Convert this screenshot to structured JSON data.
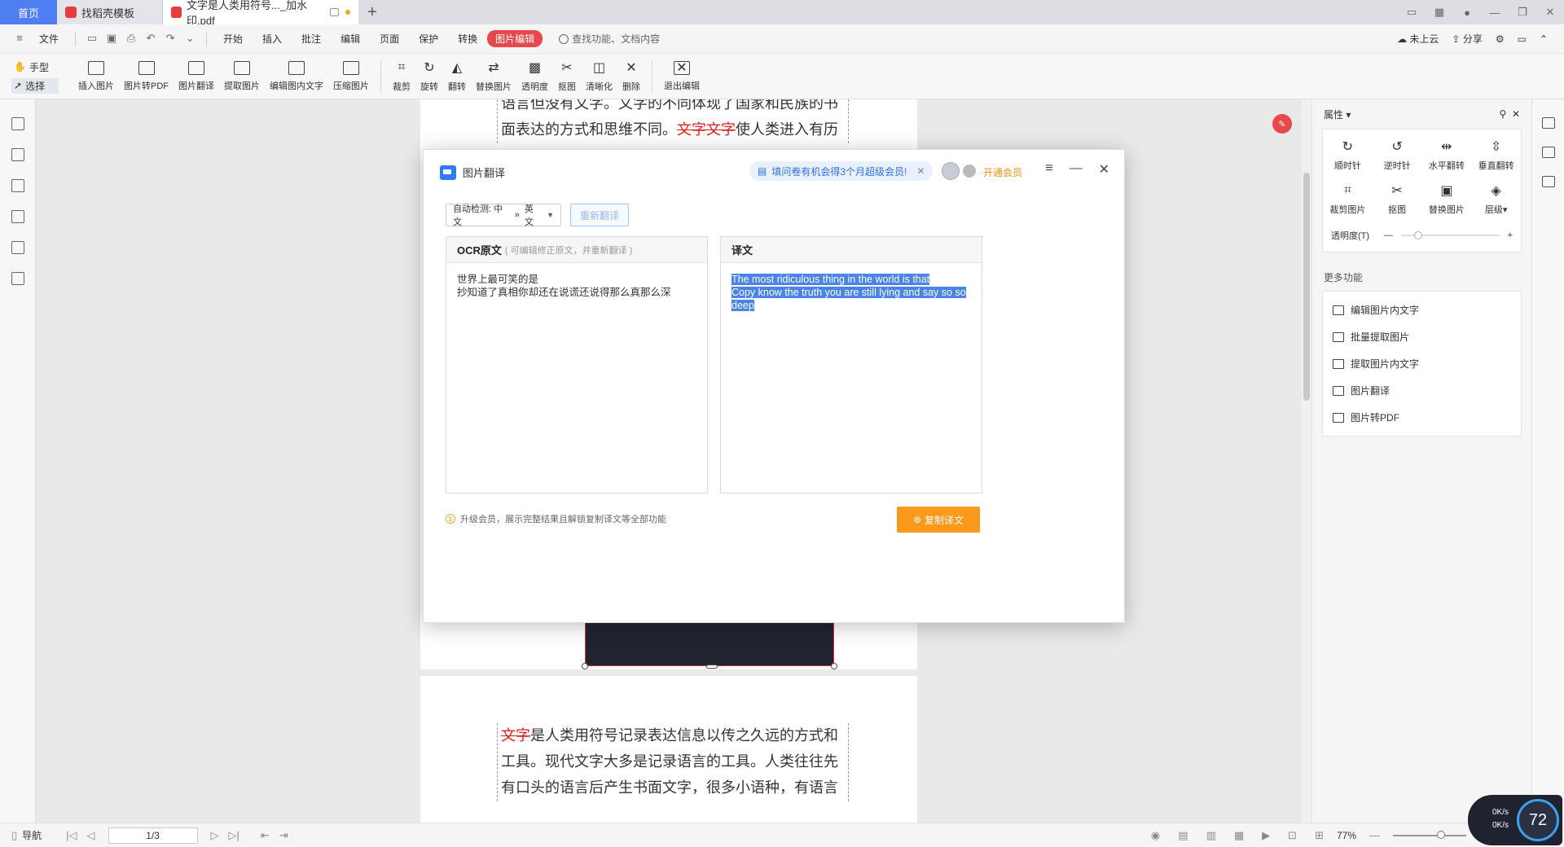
{
  "tabs": {
    "home": "首页",
    "template": "找稻壳模板",
    "doc": "文字是人类用符号..._加水印.pdf"
  },
  "menu": {
    "file": "文件",
    "items": [
      "开始",
      "插入",
      "批注",
      "编辑",
      "页面",
      "保护",
      "转换"
    ],
    "active": "图片编辑",
    "search": "查找功能、文档内容",
    "cloud": "未上云",
    "share": "分享"
  },
  "ribbon": {
    "hand": "手型",
    "select": "选择",
    "buttons": [
      "插入图片",
      "图片转PDF",
      "图片翻译",
      "提取图片",
      "编辑图内文字",
      "压缩图片",
      "裁剪",
      "旋转",
      "翻转",
      "替换图片",
      "透明度",
      "抠图",
      "清晰化",
      "删除",
      "退出编辑"
    ]
  },
  "document": {
    "page1_lines": [
      "语言但没有文字。文字的不同体现了国家和民族的书",
      "面表达的方式和思维不同。"
    ],
    "page1_red": "文字文字",
    "page1_tail": "使人类进入有历",
    "page2_red": "文字",
    "page2_lines": [
      "是人类用符号记录表达信息以传之久远的方式和",
      "工具。现代文字大多是记录语言的工具。人类往往先",
      "有口头的语言后产生书面文字，很多小语种，有语言"
    ]
  },
  "dialog": {
    "title": "图片翻译",
    "promo": "填问卷有机会得3个月超级会员!",
    "vip": "开通会员",
    "lang_detect": "自动检测: 中文",
    "lang_target": "英文",
    "retranslate": "重新翻译",
    "ocr_header": "OCR原文",
    "ocr_hint": "( 可编辑修正原文，并重新翻译 )",
    "ocr_lines": [
      "世界上最可笑的是",
      "抄知道了真相你却还在说谎还说得那么真那么深"
    ],
    "trans_header": "译文",
    "trans_lines": [
      "The most ridiculous thing in the world is that",
      "Copy know the truth you are still lying and say so so",
      "deep"
    ],
    "footer": "升级会员，展示完整结果且解锁复制译文等全部功能",
    "copy": "复制译文"
  },
  "props": {
    "header": "属性",
    "grid": [
      "顺时针",
      "逆时针",
      "水平翻转",
      "垂直翻转",
      "裁剪图片",
      "抠图",
      "替换图片",
      "层级"
    ],
    "opacity": "透明度(T)",
    "more_header": "更多功能",
    "more": [
      "编辑图片内文字",
      "批量提取图片",
      "提取图片内文字",
      "图片翻译",
      "图片转PDF"
    ]
  },
  "status": {
    "nav": "导航",
    "page": "1/3",
    "zoom": "77%"
  },
  "speed": {
    "up": "0K/s",
    "down": "0K/s",
    "value": "72"
  },
  "colors": {
    "accent": "#4e7ef1",
    "active_tab": "#e8484d",
    "copy_button": "#fb9a1a",
    "highlight": "#4a84e8"
  }
}
